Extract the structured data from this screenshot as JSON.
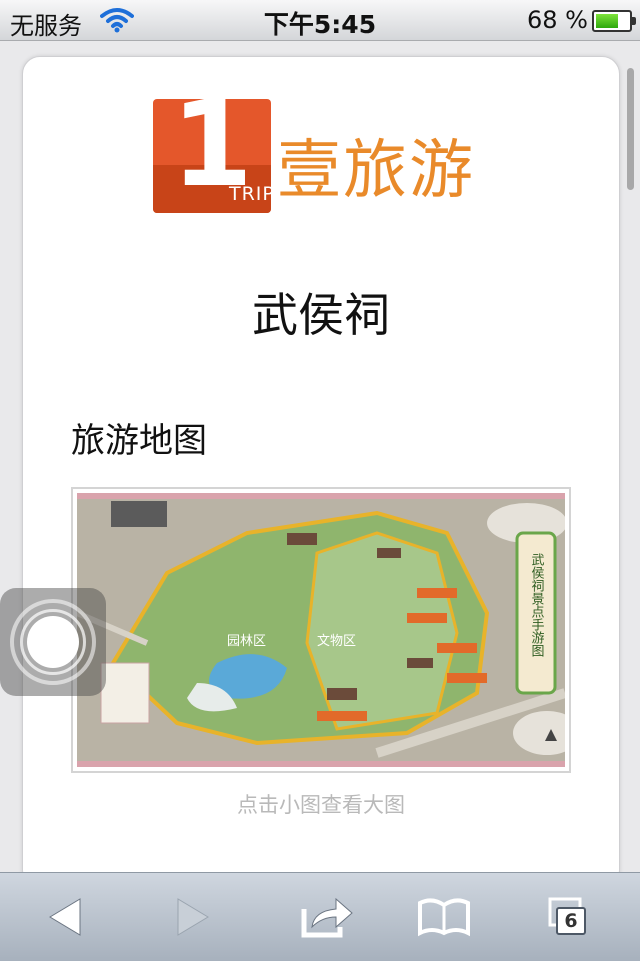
{
  "status_bar": {
    "carrier": "无服务",
    "time": "下午5:45",
    "battery_percent": "68 %",
    "battery_level": 0.68
  },
  "page": {
    "logo": {
      "text": "壹旅游",
      "badge_number": "1",
      "badge_sub": "TRIP"
    },
    "title": "武侯祠",
    "section_title": "旅游地图",
    "map": {
      "zone_labels": [
        "园林区",
        "文物区"
      ],
      "side_banner": "武侯祠景点手游图"
    },
    "caption": "点击小图查看大图"
  },
  "toolbar": {
    "tab_count": "6",
    "icons": [
      "back-arrow-icon",
      "forward-arrow-icon",
      "share-icon",
      "bookmarks-icon",
      "tabs-icon"
    ]
  },
  "colors": {
    "logo_orange": "#e4572b",
    "logo_text": "#e98a2a",
    "caption": "#b9b9b9",
    "toolbar": "#b7c0cb"
  }
}
